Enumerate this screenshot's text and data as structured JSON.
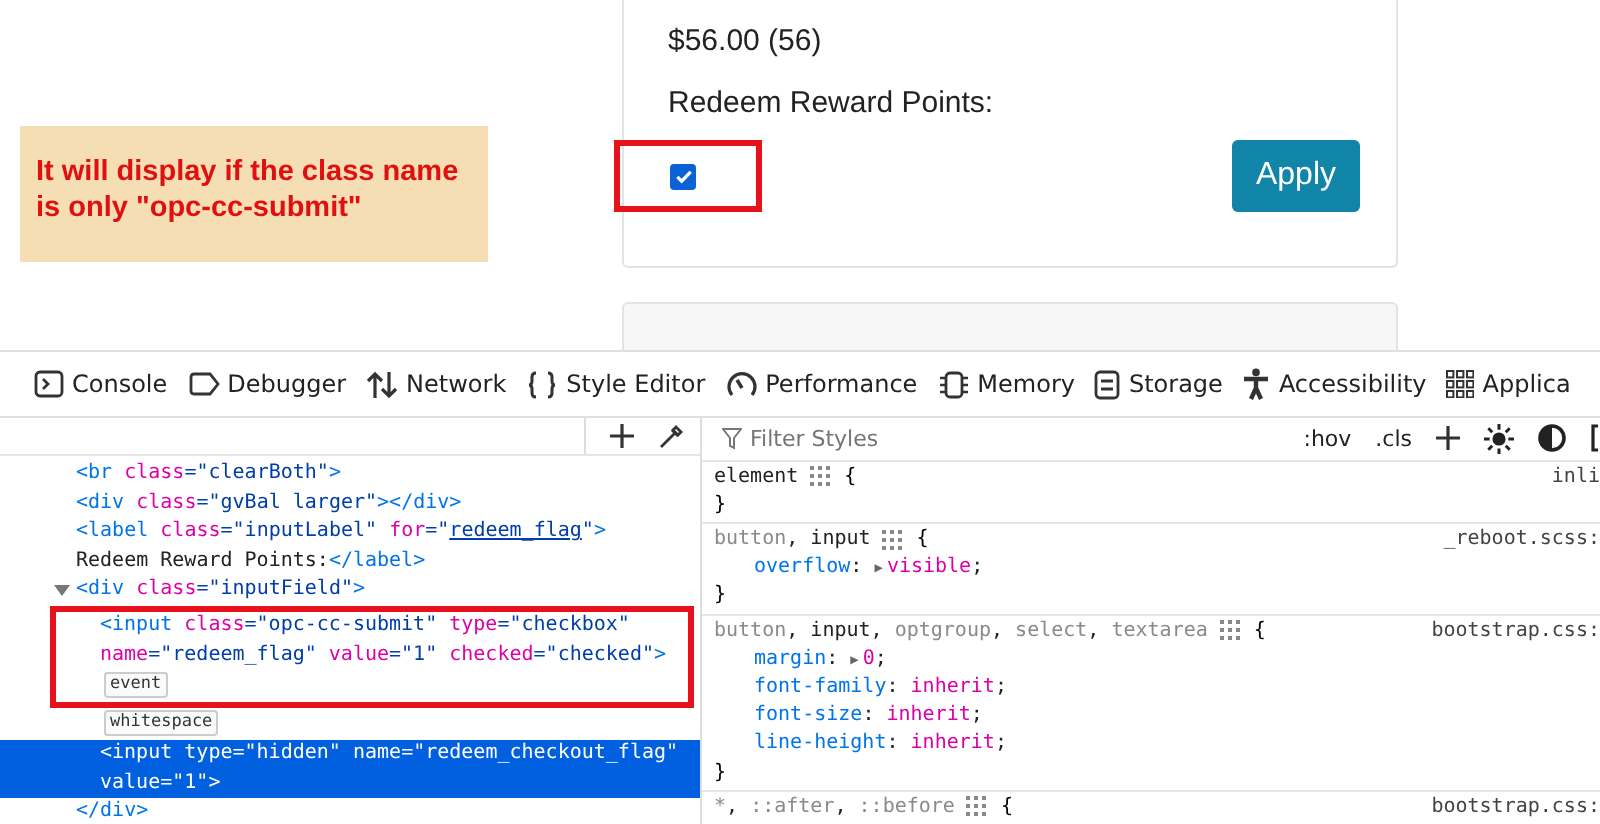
{
  "page": {
    "balance": "$56.00 (56)",
    "redeem_label": "Redeem Reward Points:",
    "redeem_checkbox": {
      "checked": true,
      "highlight_box": true
    },
    "apply_button": "Apply"
  },
  "note": "It will display if the class name is only \"opc-cc-submit\"",
  "devtools": {
    "tabs": [
      {
        "label": "Console",
        "selected": false
      },
      {
        "label": "Debugger",
        "selected": false
      },
      {
        "label": "Network",
        "selected": false
      },
      {
        "label": "Style Editor",
        "selected": false
      },
      {
        "label": "Performance",
        "selected": false
      },
      {
        "label": "Memory",
        "selected": false
      },
      {
        "label": "Storage",
        "selected": false
      },
      {
        "label": "Accessibility",
        "selected": false
      },
      {
        "label": "Applica",
        "selected": false
      }
    ],
    "markup": [
      {
        "lines": [
          [
            {
              "kind": "tag",
              "text": "<br "
            },
            {
              "kind": "attr",
              "text": "class"
            },
            {
              "kind": "value",
              "text": "=\"clearBoth\""
            },
            {
              "kind": "tag",
              "text": ">"
            }
          ]
        ]
      },
      {
        "lines": [
          [
            {
              "kind": "tag",
              "text": "<div "
            },
            {
              "kind": "attr",
              "text": "class"
            },
            {
              "kind": "value",
              "text": "=\"gvBal larger\""
            },
            {
              "kind": "tag",
              "text": "></div>"
            }
          ]
        ]
      },
      {
        "lines": [
          [
            {
              "kind": "tag",
              "text": "<label "
            },
            {
              "kind": "attr",
              "text": "class"
            },
            {
              "kind": "value",
              "text": "=\"inputLabel\" "
            },
            {
              "kind": "attr",
              "text": "for"
            },
            {
              "kind": "value",
              "text": "=\""
            },
            {
              "kind": "link",
              "text": "redeem_flag"
            },
            {
              "kind": "value",
              "text": "\""
            },
            {
              "kind": "tag",
              "text": ">"
            }
          ],
          [
            {
              "kind": "text",
              "text": "Redeem Reward Points:"
            },
            {
              "kind": "tag",
              "text": "</label>"
            }
          ]
        ]
      },
      {
        "expanded": true,
        "lines": [
          [
            {
              "kind": "tag",
              "text": "<div "
            },
            {
              "kind": "attr",
              "text": "class"
            },
            {
              "kind": "value",
              "text": "=\"inputField\""
            },
            {
              "kind": "tag",
              "text": ">"
            }
          ]
        ],
        "children": [
          {
            "highlight_box": true,
            "selected": false,
            "badge": "event",
            "lines": [
              [
                {
                  "kind": "tag",
                  "text": "<input "
                },
                {
                  "kind": "attr",
                  "text": "class"
                },
                {
                  "kind": "value",
                  "text": "=\"opc-cc-submit\" "
                },
                {
                  "kind": "attr",
                  "text": "type"
                },
                {
                  "kind": "value",
                  "text": "=\"checkbox\""
                }
              ],
              [
                {
                  "kind": "attr",
                  "text": "name"
                },
                {
                  "kind": "value",
                  "text": "=\"redeem_flag\" "
                },
                {
                  "kind": "attr",
                  "text": "value"
                },
                {
                  "kind": "value",
                  "text": "=\"1\" "
                },
                {
                  "kind": "attr",
                  "text": "checked"
                },
                {
                  "kind": "value",
                  "text": "=\"checked\""
                },
                {
                  "kind": "tag",
                  "text": ">"
                }
              ]
            ]
          },
          {
            "highlight_box": false,
            "selected": false,
            "badge": "whitespace"
          },
          {
            "highlight_box": false,
            "selected": true,
            "lines": [
              [
                {
                  "kind": "tag",
                  "text": "<input "
                },
                {
                  "kind": "attr",
                  "text": "type"
                },
                {
                  "kind": "value",
                  "text": "=\"hidden\" "
                },
                {
                  "kind": "attr",
                  "text": "name"
                },
                {
                  "kind": "value",
                  "text": "=\"redeem_checkout_flag\""
                }
              ],
              [
                {
                  "kind": "attr",
                  "text": "value"
                },
                {
                  "kind": "value",
                  "text": "=\"1\""
                },
                {
                  "kind": "tag",
                  "text": ">"
                }
              ]
            ]
          }
        ],
        "closing": "</div>"
      }
    ],
    "filter_placeholder": "Filter Styles",
    "hov": ":hov",
    "cls": ".cls",
    "rules": [
      {
        "selector": [
          {
            "kind": "match",
            "text": "element"
          }
        ],
        "open": "{",
        "source": "inli",
        "close": "}"
      },
      {
        "selector": [
          {
            "kind": "nomatch",
            "text": "button"
          },
          {
            "kind": "punct",
            "text": ", "
          },
          {
            "kind": "match",
            "text": "input"
          }
        ],
        "open": "{",
        "source": "_reboot.scss:",
        "declarations": [
          [
            {
              "kind": "prop",
              "text": "overflow"
            },
            {
              "kind": "punct",
              "text": ": "
            },
            {
              "kind": "arrow",
              "text": "▶"
            },
            {
              "kind": "value",
              "text": "visible"
            },
            {
              "kind": "punct",
              "text": ";"
            }
          ]
        ],
        "close": "}"
      },
      {
        "selector": [
          {
            "kind": "nomatch",
            "text": "button"
          },
          {
            "kind": "punct",
            "text": ", "
          },
          {
            "kind": "match",
            "text": "input"
          },
          {
            "kind": "punct",
            "text": ", "
          },
          {
            "kind": "nomatch",
            "text": "optgroup"
          },
          {
            "kind": "punct",
            "text": ", "
          },
          {
            "kind": "nomatch",
            "text": "select"
          },
          {
            "kind": "punct",
            "text": ", "
          },
          {
            "kind": "nomatch",
            "text": "textarea"
          }
        ],
        "open": "{",
        "source": "bootstrap.css:",
        "declarations": [
          [
            {
              "kind": "prop",
              "text": "margin"
            },
            {
              "kind": "punct",
              "text": ": "
            },
            {
              "kind": "arrow",
              "text": "▶"
            },
            {
              "kind": "value",
              "text": "0"
            },
            {
              "kind": "punct",
              "text": ";"
            }
          ],
          [
            {
              "kind": "prop",
              "text": "font-family"
            },
            {
              "kind": "punct",
              "text": ": "
            },
            {
              "kind": "value",
              "text": "inherit"
            },
            {
              "kind": "punct",
              "text": ";"
            }
          ],
          [
            {
              "kind": "prop",
              "text": "font-size"
            },
            {
              "kind": "punct",
              "text": ": "
            },
            {
              "kind": "value",
              "text": "inherit"
            },
            {
              "kind": "punct",
              "text": ";"
            }
          ],
          [
            {
              "kind": "prop",
              "text": "line-height"
            },
            {
              "kind": "punct",
              "text": ": "
            },
            {
              "kind": "value",
              "text": "inherit"
            },
            {
              "kind": "punct",
              "text": ";"
            }
          ]
        ],
        "close": "}"
      },
      {
        "selector": [
          {
            "kind": "nomatch",
            "text": "*"
          },
          {
            "kind": "punct",
            "text": ", "
          },
          {
            "kind": "nomatch",
            "text": "::after"
          },
          {
            "kind": "punct",
            "text": ", "
          },
          {
            "kind": "nomatch",
            "text": "::before"
          }
        ],
        "open": "{",
        "source": "bootstrap.css:"
      }
    ]
  }
}
